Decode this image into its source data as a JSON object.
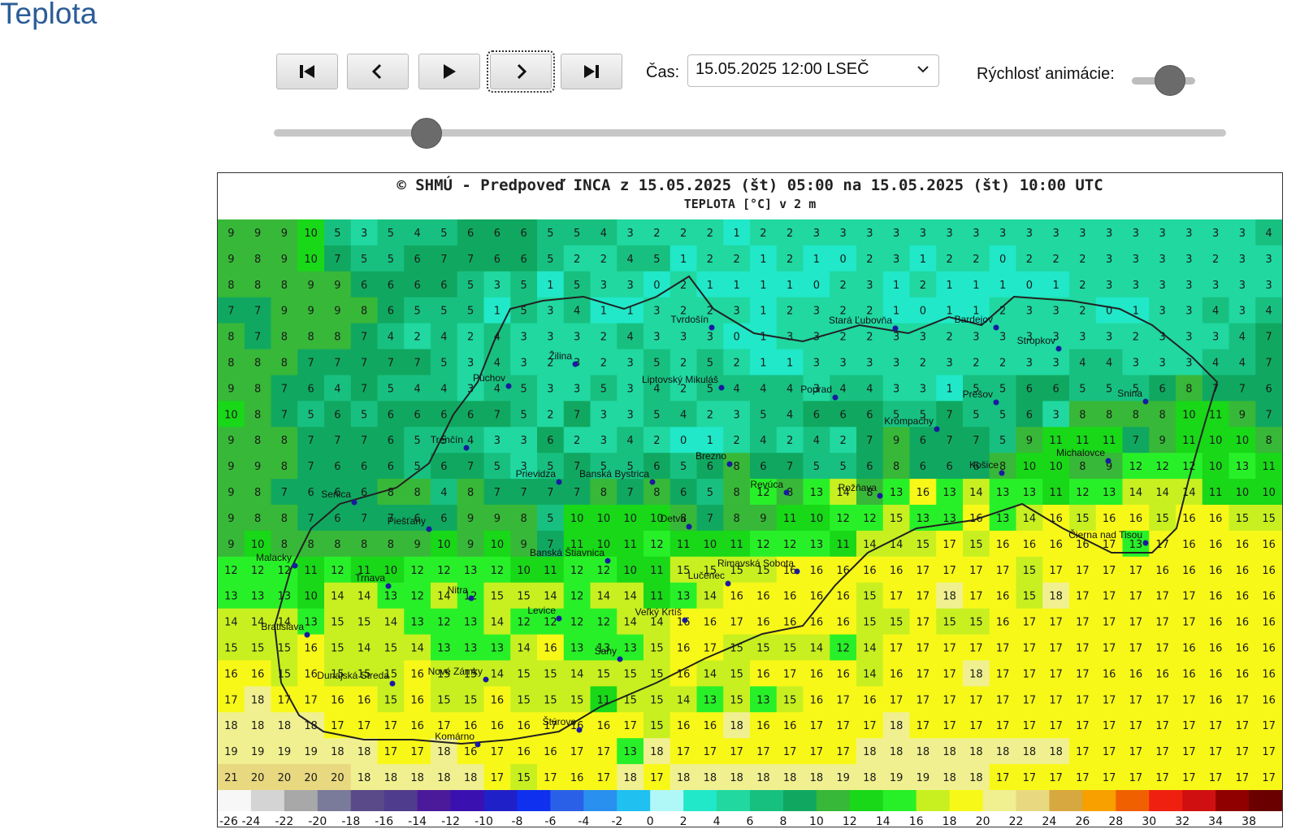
{
  "page": {
    "title": "Teplota"
  },
  "controls": {
    "buttons": [
      {
        "name": "first-frame-button",
        "icon": "skip-to-first-icon"
      },
      {
        "name": "previous-frame-button",
        "icon": "chevron-left-icon"
      },
      {
        "name": "play-button",
        "icon": "play-icon"
      },
      {
        "name": "next-frame-button",
        "icon": "chevron-right-icon",
        "focused": true
      },
      {
        "name": "last-frame-button",
        "icon": "skip-to-last-icon"
      }
    ],
    "time_label": "Čas:",
    "time_selected": "15.05.2025 12:00 LSEČ",
    "speed_label": "Rýchlosť animácie:",
    "speed_value": 0.6,
    "timeline_position": 0.16
  },
  "map": {
    "title_line1": "© SHMÚ - Predpoveď   INCA z 15.05.2025 (št) 05:00 na 15.05.2025 (št) 10:00 UTC",
    "title_line2": "TEPLOTA [°C] v 2 m",
    "cities": [
      "Tvrdošín",
      "Stará Ľubovňa",
      "Bardejov",
      "Stropkov",
      "Žilina",
      "Púchov",
      "Liptovský Mikuláš",
      "Poprad",
      "Prešov",
      "Snina",
      "Krompachy",
      "Trenčín",
      "Brezno",
      "Michalovce",
      "Prievidza",
      "Banská Bystrica",
      "Košice",
      "Revúca",
      "Rožňava",
      "Senica",
      "Piešťany",
      "Detva",
      "Čierna nad Tisou",
      "Banská Štiavnica",
      "Malacky",
      "Rimavská Sobota",
      "Trnava",
      "Lučenec",
      "Nitra",
      "Levice",
      "Veľký Krtíš",
      "Bratislava",
      "Šahy",
      "Nové Zámky",
      "Dunajská Streda",
      "Štúrovo",
      "Komárno"
    ],
    "temperature_rows": [
      [
        9,
        9,
        9,
        10,
        5,
        3,
        5,
        4,
        5,
        6,
        6,
        6,
        5,
        5,
        4,
        3,
        2,
        2,
        2,
        1,
        2,
        2,
        3,
        3,
        3,
        3,
        3,
        3,
        3,
        3,
        3,
        3,
        3,
        3,
        3,
        3,
        3,
        3,
        3,
        4
      ],
      [
        9,
        8,
        9,
        10,
        7,
        5,
        5,
        6,
        7,
        7,
        6,
        6,
        5,
        2,
        2,
        4,
        5,
        1,
        2,
        2,
        1,
        2,
        1,
        0,
        2,
        3,
        1,
        2,
        2,
        0,
        2,
        2,
        2,
        3,
        3,
        3,
        3,
        2,
        3,
        3
      ],
      [
        8,
        8,
        8,
        9,
        9,
        6,
        6,
        6,
        6,
        5,
        3,
        5,
        1,
        5,
        3,
        3,
        0,
        2,
        1,
        1,
        1,
        1,
        0,
        2,
        3,
        1,
        2,
        1,
        1,
        1,
        0,
        1,
        2,
        3,
        3,
        3,
        3,
        3,
        3,
        3
      ],
      [
        7,
        7,
        9,
        9,
        9,
        8,
        6,
        5,
        5,
        5,
        1,
        5,
        3,
        4,
        1,
        1,
        3,
        2,
        2,
        3,
        1,
        2,
        3,
        2,
        2,
        1,
        0,
        1,
        1,
        2,
        3,
        3,
        2,
        0,
        1,
        3,
        3,
        4,
        3,
        4
      ],
      [
        8,
        7,
        8,
        8,
        8,
        7,
        4,
        2,
        4,
        2,
        4,
        3,
        3,
        3,
        2,
        4,
        3,
        3,
        3,
        0,
        1,
        3,
        3,
        2,
        2,
        3,
        3,
        2,
        3,
        3,
        3,
        3,
        3,
        3,
        2,
        3,
        3,
        3,
        4,
        7
      ],
      [
        8,
        8,
        8,
        7,
        7,
        7,
        7,
        7,
        5,
        3,
        4,
        3,
        2,
        3,
        2,
        3,
        5,
        2,
        5,
        2,
        1,
        1,
        3,
        3,
        3,
        3,
        2,
        3,
        2,
        2,
        3,
        3,
        4,
        4,
        3,
        3,
        3,
        4,
        4,
        7
      ],
      [
        9,
        8,
        7,
        6,
        4,
        7,
        5,
        4,
        4,
        3,
        4,
        5,
        3,
        3,
        5,
        3,
        4,
        2,
        5,
        4,
        4,
        4,
        3,
        4,
        4,
        3,
        3,
        1,
        5,
        5,
        6,
        6,
        5,
        5,
        5,
        6,
        8,
        7,
        7,
        6
      ],
      [
        10,
        8,
        7,
        5,
        6,
        5,
        6,
        6,
        6,
        6,
        7,
        5,
        2,
        7,
        3,
        3,
        5,
        4,
        2,
        3,
        5,
        4,
        6,
        6,
        6,
        5,
        5,
        7,
        5,
        5,
        6,
        3,
        8,
        8,
        8,
        8,
        10,
        11,
        9,
        7
      ],
      [
        9,
        8,
        8,
        7,
        7,
        7,
        6,
        5,
        5,
        4,
        3,
        3,
        6,
        2,
        3,
        4,
        2,
        0,
        1,
        2,
        4,
        2,
        4,
        2,
        7,
        9,
        6,
        7,
        7,
        5,
        9,
        11,
        11,
        11,
        7,
        9,
        11,
        10,
        10,
        8
      ],
      [
        9,
        9,
        8,
        7,
        6,
        6,
        6,
        5,
        6,
        7,
        5,
        3,
        5,
        7,
        5,
        5,
        6,
        5,
        6,
        8,
        6,
        7,
        5,
        5,
        6,
        8,
        6,
        6,
        6,
        8,
        10,
        10,
        8,
        9,
        12,
        12,
        12,
        10,
        13,
        11
      ],
      [
        9,
        8,
        7,
        6,
        6,
        6,
        8,
        8,
        4,
        8,
        7,
        7,
        7,
        7,
        8,
        7,
        8,
        6,
        5,
        8,
        12,
        8,
        13,
        14,
        8,
        13,
        16,
        13,
        14,
        13,
        13,
        11,
        12,
        13,
        14,
        14,
        14,
        11,
        10,
        10
      ],
      [
        9,
        8,
        8,
        7,
        6,
        7,
        7,
        6,
        6,
        9,
        9,
        8,
        5,
        10,
        10,
        10,
        10,
        8,
        7,
        8,
        9,
        11,
        10,
        12,
        12,
        15,
        13,
        13,
        16,
        13,
        14,
        16,
        15,
        16,
        16,
        15,
        16,
        16,
        15,
        15
      ],
      [
        9,
        10,
        8,
        8,
        8,
        8,
        8,
        9,
        10,
        9,
        10,
        9,
        7,
        11,
        10,
        11,
        12,
        11,
        10,
        11,
        12,
        12,
        13,
        11,
        14,
        14,
        15,
        17,
        15,
        16,
        16,
        16,
        16,
        17,
        13,
        17,
        16,
        16,
        16,
        16
      ],
      [
        12,
        12,
        12,
        11,
        12,
        11,
        10,
        12,
        12,
        13,
        12,
        10,
        11,
        12,
        12,
        10,
        11,
        15,
        15,
        15,
        15,
        16,
        16,
        16,
        16,
        16,
        17,
        17,
        17,
        17,
        15,
        17,
        17,
        17,
        17,
        16,
        16,
        16,
        16,
        16
      ],
      [
        13,
        13,
        13,
        10,
        14,
        14,
        13,
        12,
        14,
        12,
        15,
        15,
        14,
        12,
        14,
        14,
        11,
        13,
        14,
        16,
        16,
        16,
        16,
        16,
        15,
        17,
        17,
        18,
        17,
        16,
        15,
        18,
        17,
        17,
        17,
        17,
        17,
        16,
        16,
        16
      ],
      [
        14,
        14,
        14,
        13,
        15,
        15,
        14,
        13,
        12,
        13,
        14,
        12,
        12,
        12,
        12,
        14,
        14,
        16,
        16,
        17,
        16,
        16,
        16,
        16,
        15,
        15,
        17,
        15,
        15,
        16,
        17,
        17,
        17,
        17,
        17,
        17,
        17,
        16,
        16,
        16
      ],
      [
        15,
        15,
        15,
        16,
        15,
        14,
        15,
        14,
        13,
        13,
        13,
        14,
        16,
        13,
        13,
        13,
        15,
        16,
        17,
        15,
        15,
        15,
        14,
        12,
        14,
        17,
        17,
        17,
        17,
        17,
        17,
        17,
        17,
        17,
        17,
        17,
        16,
        16,
        16,
        16
      ],
      [
        16,
        16,
        15,
        16,
        15,
        15,
        15,
        16,
        15,
        15,
        14,
        15,
        15,
        14,
        15,
        15,
        15,
        16,
        14,
        15,
        16,
        17,
        16,
        16,
        14,
        16,
        17,
        17,
        18,
        17,
        17,
        17,
        17,
        16,
        16,
        16,
        16,
        16,
        16,
        16
      ],
      [
        17,
        18,
        17,
        17,
        16,
        16,
        15,
        16,
        15,
        15,
        16,
        15,
        15,
        15,
        11,
        15,
        15,
        14,
        13,
        15,
        13,
        15,
        16,
        17,
        16,
        17,
        17,
        17,
        17,
        17,
        17,
        17,
        17,
        17,
        17,
        17,
        17,
        16,
        17,
        16
      ],
      [
        18,
        18,
        18,
        18,
        17,
        17,
        17,
        16,
        17,
        16,
        16,
        16,
        17,
        16,
        16,
        17,
        15,
        16,
        16,
        18,
        16,
        16,
        17,
        17,
        17,
        18,
        17,
        17,
        17,
        17,
        17,
        17,
        17,
        17,
        17,
        17,
        17,
        17,
        17,
        17
      ],
      [
        19,
        19,
        19,
        19,
        18,
        18,
        17,
        17,
        18,
        16,
        17,
        16,
        16,
        17,
        17,
        13,
        18,
        17,
        17,
        17,
        17,
        17,
        17,
        17,
        18,
        18,
        18,
        18,
        18,
        18,
        18,
        18,
        17,
        17,
        17,
        17,
        17,
        17,
        17,
        17
      ],
      [
        21,
        20,
        20,
        20,
        20,
        18,
        18,
        18,
        18,
        18,
        17,
        15,
        17,
        16,
        17,
        18,
        17,
        18,
        18,
        18,
        18,
        18,
        18,
        19,
        18,
        19,
        19,
        18,
        18,
        17,
        17,
        17,
        17,
        17,
        17,
        17,
        17,
        17,
        17,
        17
      ]
    ],
    "color_scale": {
      "labels": [
        "-26",
        "-24",
        "-22",
        "-20",
        "-18",
        "-16",
        "-14",
        "-12",
        "-10",
        "-8",
        "-6",
        "-4",
        "-2",
        "0",
        "2",
        "4",
        "6",
        "8",
        "10",
        "12",
        "14",
        "16",
        "18",
        "20",
        "22",
        "24",
        "26",
        "28",
        "30",
        "32",
        "34",
        "38"
      ],
      "colors": [
        "#f7f7f7",
        "#d4d4d4",
        "#a8a8a8",
        "#7a7a9a",
        "#5a4a8a",
        "#503c8c",
        "#4a1a9a",
        "#3a10b0",
        "#2020c8",
        "#1030f0",
        "#2a60e8",
        "#2a90f0",
        "#20c0f0",
        "#b0f8f8",
        "#20e8c8",
        "#20d8a0",
        "#18c080",
        "#10a860",
        "#38b838",
        "#18d818",
        "#28f028",
        "#c8f020",
        "#f8f818",
        "#f0f090",
        "#e8d880",
        "#d8a840",
        "#f8a000",
        "#f06000",
        "#f02010",
        "#d01010",
        "#900000",
        "#6a0000"
      ]
    }
  }
}
